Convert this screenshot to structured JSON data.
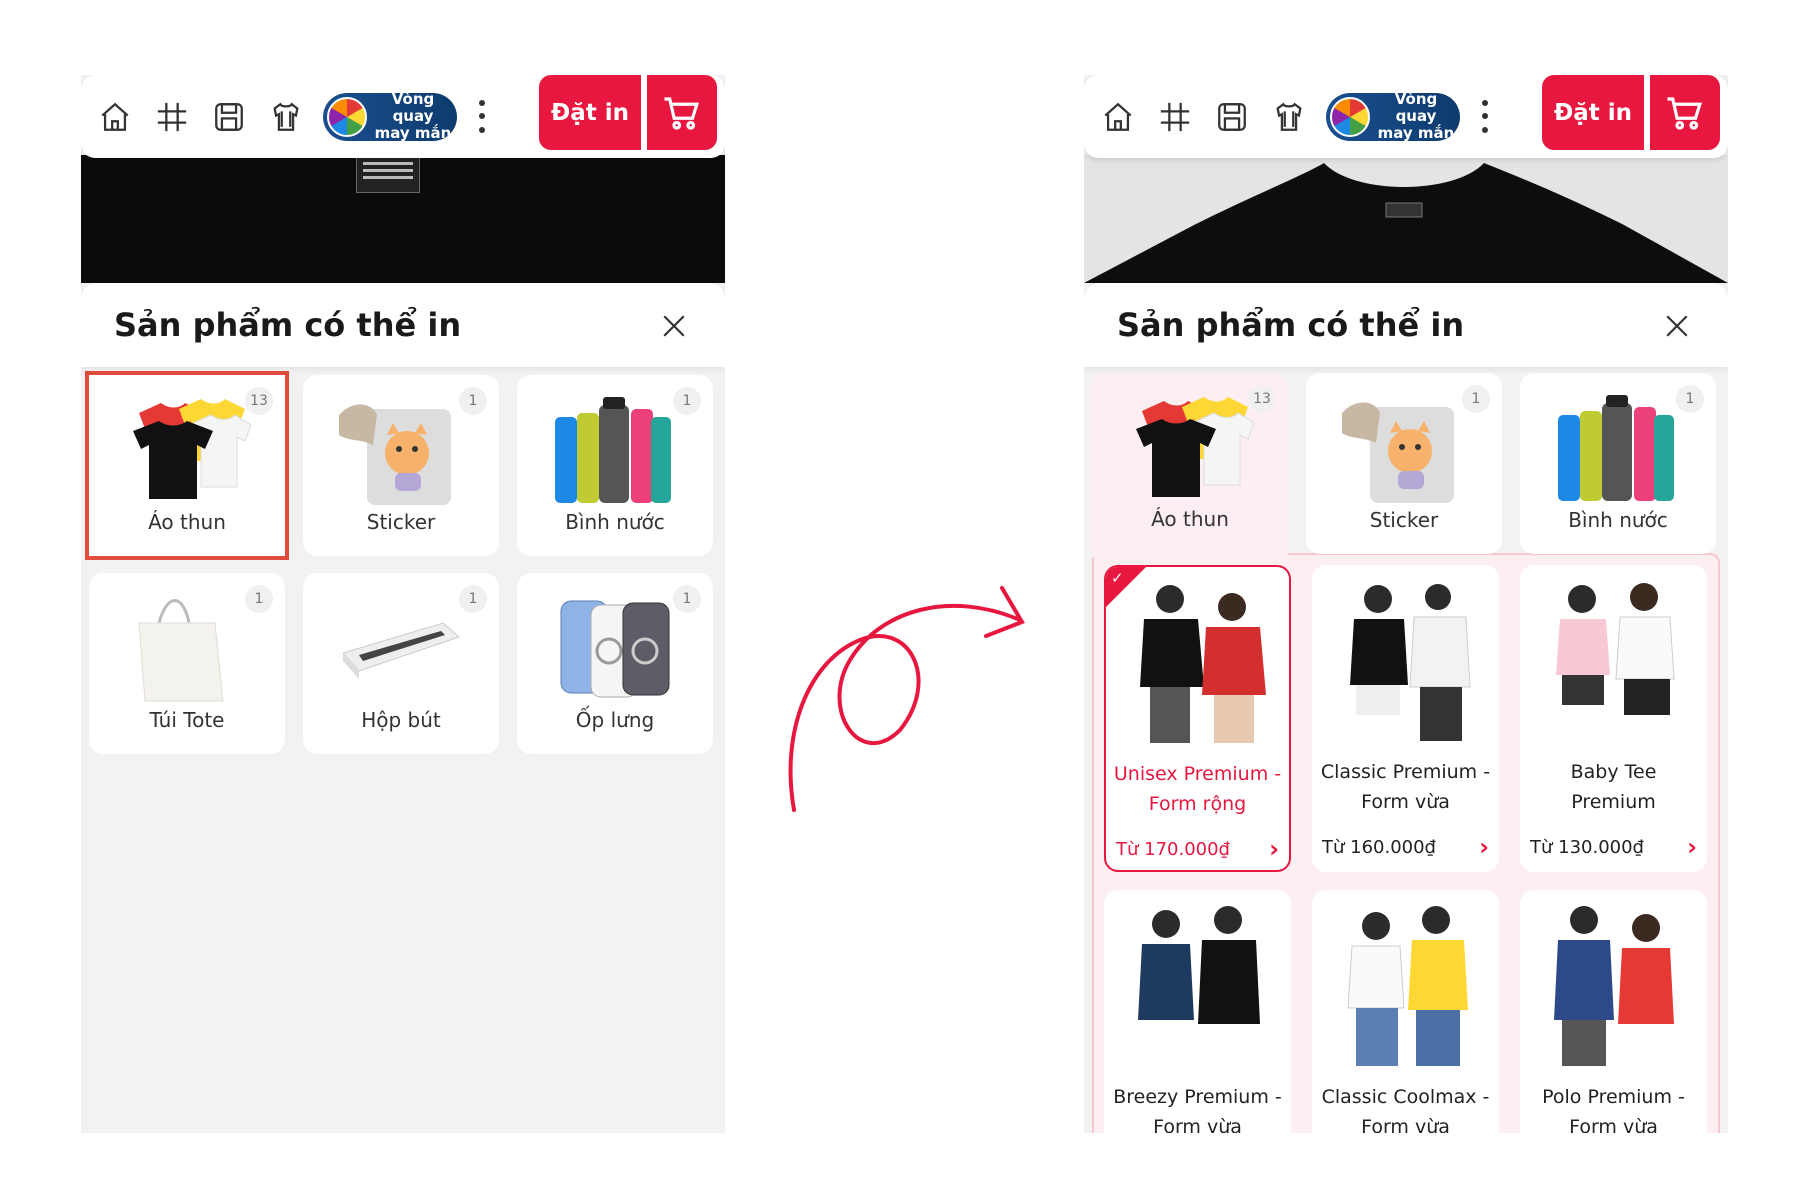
{
  "toolbar": {
    "spin_line1": "Vòng quay",
    "spin_line2": "may mắn",
    "order_label": "Đặt in",
    "icons": [
      "home-icon",
      "grid-icon",
      "save-icon",
      "shirt-icon",
      "cart-icon"
    ]
  },
  "sheet": {
    "title": "Sản phẩm có thể in"
  },
  "categories": [
    {
      "label": "Áo thun",
      "count": "13"
    },
    {
      "label": "Sticker",
      "count": "1"
    },
    {
      "label": "Bình nước",
      "count": "1"
    },
    {
      "label": "Túi Tote",
      "count": "1"
    },
    {
      "label": "Hộp bút",
      "count": "1"
    },
    {
      "label": "Ốp lưng",
      "count": "1"
    }
  ],
  "products": [
    {
      "name": "Unisex Premium - Form rộng",
      "price": "Từ 170.000₫",
      "selected": true
    },
    {
      "name": "Classic Premium - Form vừa",
      "price": "Từ 160.000₫"
    },
    {
      "name": "Baby Tee Premium",
      "price": "Từ 130.000₫"
    },
    {
      "name": "Breezy Premium - Form vừa",
      "price": ""
    },
    {
      "name": "Classic Coolmax - Form vừa",
      "price": ""
    },
    {
      "name": "Polo Premium - Form vừa",
      "price": ""
    }
  ],
  "colors": {
    "accent": "#e8173f",
    "selected_outline": "#e04c3c",
    "panel_tint": "#fdeff1"
  }
}
